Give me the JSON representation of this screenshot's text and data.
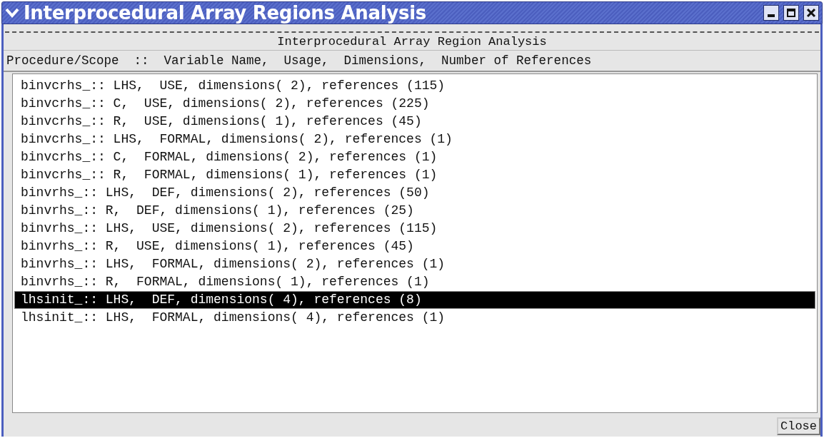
{
  "window": {
    "title": "Interprocedural Array Regions Analysis"
  },
  "panel": {
    "title": "Interprocedural Array Region Analysis",
    "header": "Procedure/Scope  ::  Variable Name,  Usage,  Dimensions,  Number of References"
  },
  "rows": [
    {
      "text": "binvcrhs_:: LHS,  USE, dimensions( 2), references (115)",
      "selected": false
    },
    {
      "text": "binvcrhs_:: C,  USE, dimensions( 2), references (225)",
      "selected": false
    },
    {
      "text": "binvcrhs_:: R,  USE, dimensions( 1), references (45)",
      "selected": false
    },
    {
      "text": "binvcrhs_:: LHS,  FORMAL, dimensions( 2), references (1)",
      "selected": false
    },
    {
      "text": "binvcrhs_:: C,  FORMAL, dimensions( 2), references (1)",
      "selected": false
    },
    {
      "text": "binvcrhs_:: R,  FORMAL, dimensions( 1), references (1)",
      "selected": false
    },
    {
      "text": "binvrhs_:: LHS,  DEF, dimensions( 2), references (50)",
      "selected": false
    },
    {
      "text": "binvrhs_:: R,  DEF, dimensions( 1), references (25)",
      "selected": false
    },
    {
      "text": "binvrhs_:: LHS,  USE, dimensions( 2), references (115)",
      "selected": false
    },
    {
      "text": "binvrhs_:: R,  USE, dimensions( 1), references (45)",
      "selected": false
    },
    {
      "text": "binvrhs_:: LHS,  FORMAL, dimensions( 2), references (1)",
      "selected": false
    },
    {
      "text": "binvrhs_:: R,  FORMAL, dimensions( 1), references (1)",
      "selected": false
    },
    {
      "text": "lhsinit_:: LHS,  DEF, dimensions( 4), references (8)",
      "selected": true
    },
    {
      "text": "lhsinit_:: LHS,  FORMAL, dimensions( 4), references (1)",
      "selected": false
    }
  ],
  "close_button": "Close"
}
